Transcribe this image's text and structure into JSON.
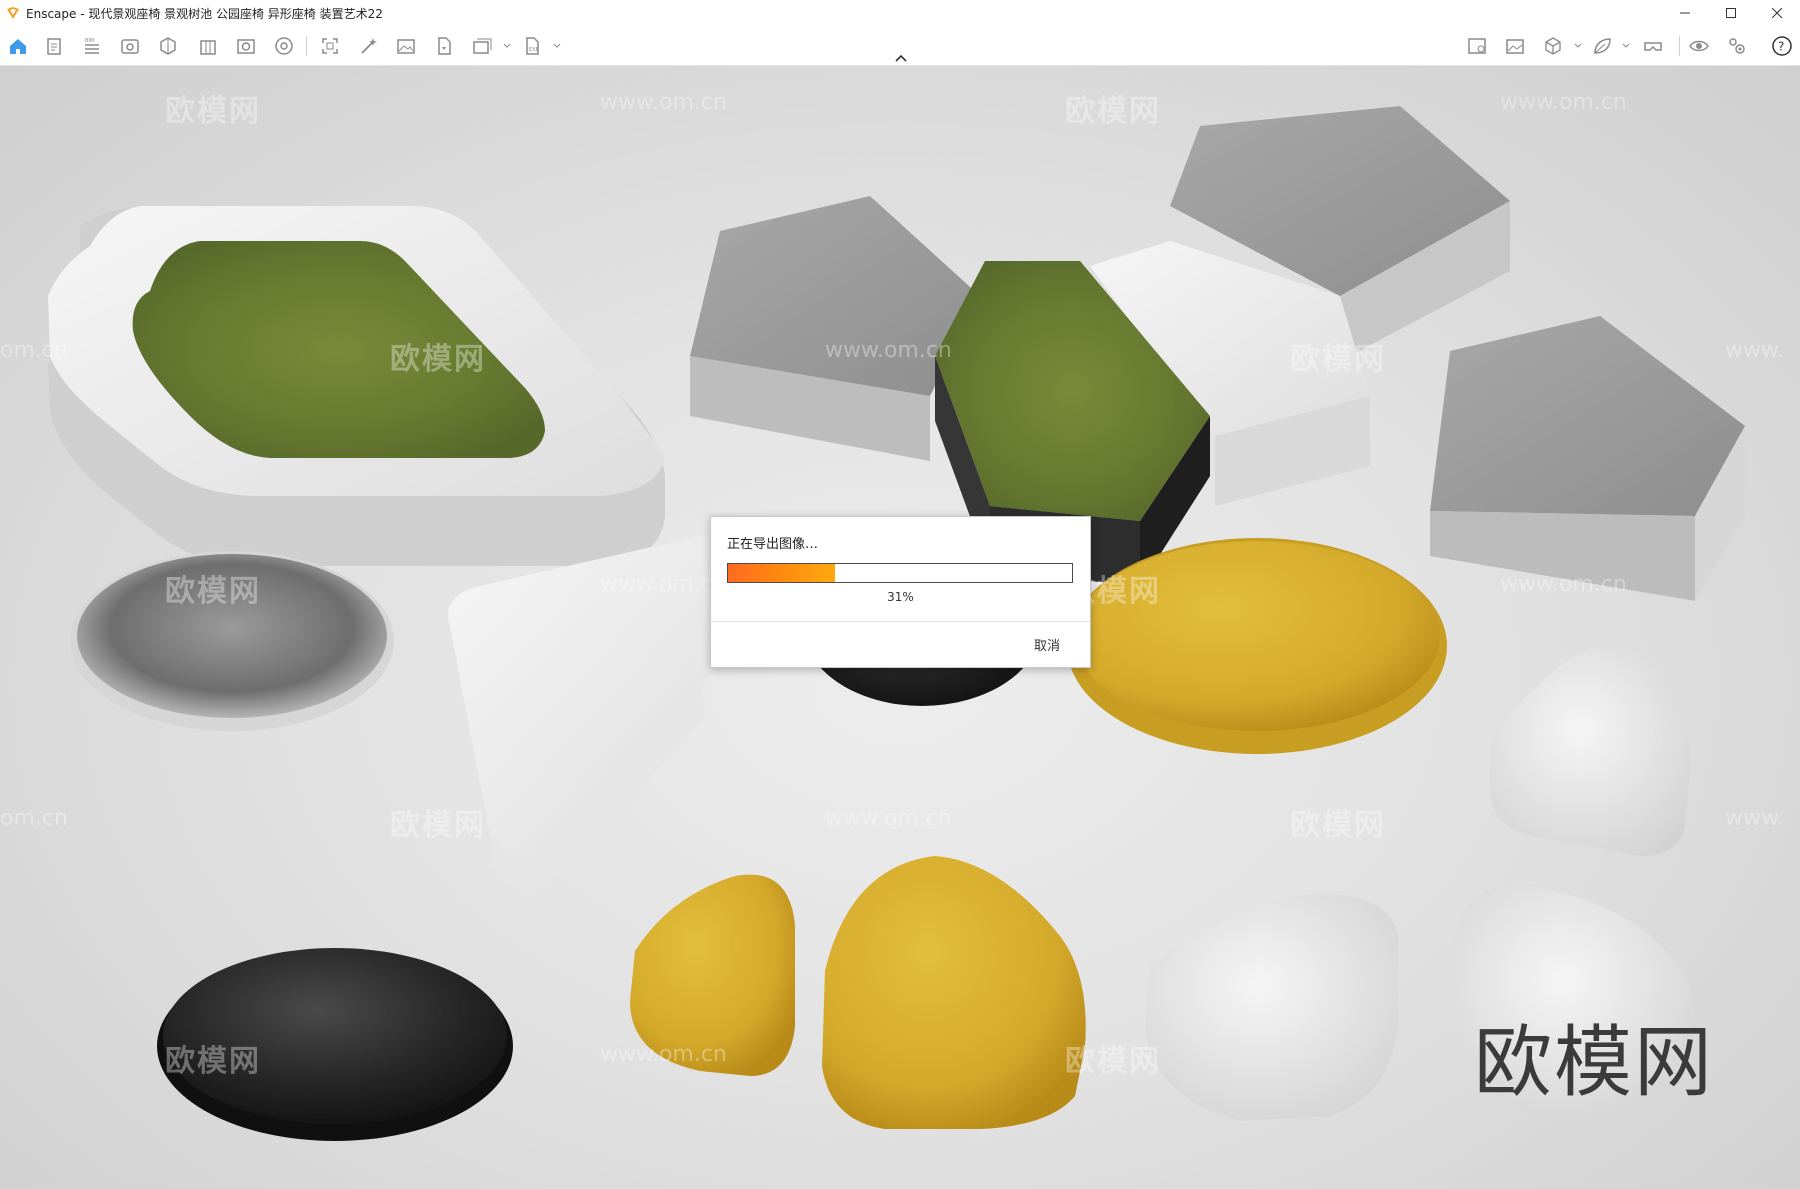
{
  "window": {
    "title": "Enscape - 现代景观座椅 景观树池 公园座椅 异形座椅 装置艺术22",
    "controls": [
      "minimize",
      "maximize",
      "close"
    ]
  },
  "toolbar": {
    "left_icons": [
      "home-icon",
      "document-icon",
      "bim-icon",
      "visibility-icon",
      "section-icon",
      "building-icon",
      "info-icon",
      "asset-library-icon",
      "screenshot-icon",
      "magic-wand-icon",
      "image-icon",
      "export-file-icon",
      "batch-render-icon",
      "exe-export-icon"
    ],
    "right_icons": [
      "views-icon",
      "render-image-icon",
      "cube-icon",
      "leaf-icon",
      "vr-headset-icon",
      "eye-icon",
      "settings-icon",
      "help-icon"
    ],
    "accent": "#3d9be9"
  },
  "watermarks": {
    "brand": "欧模网",
    "url": "www.om.cn",
    "url_cut_left": "om.cn",
    "url_cut_right": "www."
  },
  "export_dialog": {
    "title": "正在导出图像…",
    "progress_percent": 31,
    "progress_label": "31%",
    "cancel_label": "取消"
  }
}
